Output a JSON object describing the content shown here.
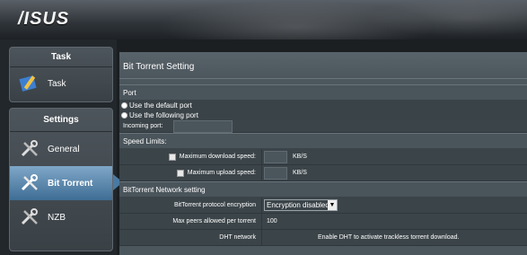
{
  "header": {
    "logo": "/ISUS"
  },
  "sidebar": {
    "task_panel": {
      "title": "Task",
      "items": [
        {
          "label": "Task",
          "icon": "task-pencil-icon"
        }
      ]
    },
    "settings_panel": {
      "title": "Settings",
      "items": [
        {
          "label": "General",
          "icon": "wrench-screwdriver-icon"
        },
        {
          "label": "Bit Torrent",
          "icon": "wrench-screwdriver-icon",
          "active": true
        },
        {
          "label": "NZB",
          "icon": "wrench-screwdriver-icon"
        }
      ]
    }
  },
  "main": {
    "title": "Bit Torrent Setting",
    "port": {
      "heading": "Port",
      "option_default": "Use the default port",
      "option_custom": "Use the following port",
      "incoming_label": "Incoming port:",
      "incoming_value": ""
    },
    "speed": {
      "heading": "Speed Limits:",
      "download_label": "Maximum download speed:",
      "download_value": "",
      "download_unit": "KB/S",
      "upload_label": "Maximum upload speed:",
      "upload_value": "",
      "upload_unit": "KB/S"
    },
    "network": {
      "heading": "BitTorrent Network setting",
      "encryption_label": "BitTorrent protocol encryption",
      "encryption_value": "Encryption disabled",
      "peers_label": "Max peers allowed per torrent",
      "peers_value": "100",
      "dht_label": "DHT network",
      "dht_note": "Enable DHT to activate trackless torrent download."
    }
  },
  "colors": {
    "active_blue": "#4a7aa2",
    "panel_bg": "#4c565d"
  }
}
